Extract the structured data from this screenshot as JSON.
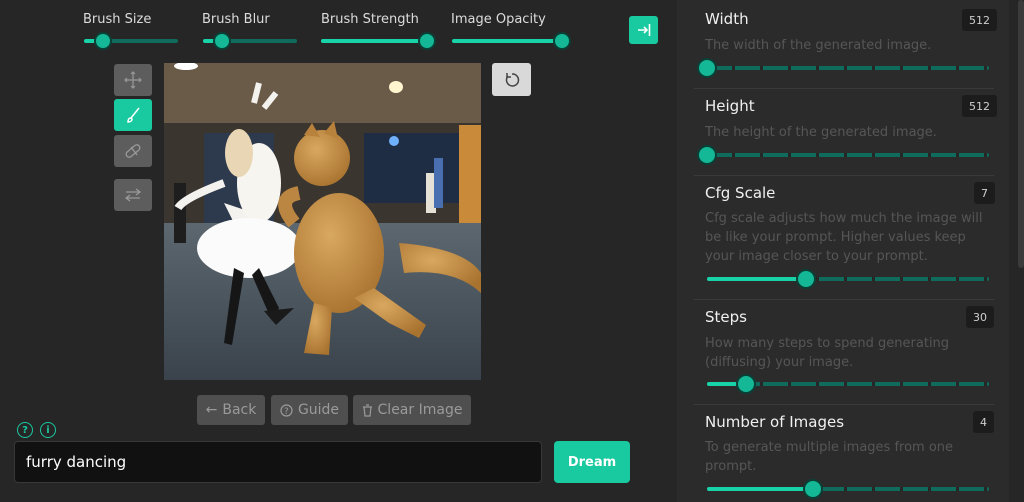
{
  "brush": {
    "size": {
      "label": "Brush Size",
      "value": 0.2
    },
    "blur": {
      "label": "Brush Blur",
      "value": 0.2
    },
    "strength": {
      "label": "Brush Strength",
      "value": 1.0
    },
    "opacity": {
      "label": "Image Opacity",
      "value": 1.0
    }
  },
  "actions": {
    "back": "Back",
    "guide": "Guide",
    "clear": "Clear Image"
  },
  "prompt": {
    "value": "furry dancing",
    "dream_label": "Dream"
  },
  "settings": {
    "width": {
      "title": "Width",
      "value": "512",
      "desc": "The width of the generated image.",
      "level": 0
    },
    "height": {
      "title": "Height",
      "value": "512",
      "desc": "The height of the generated image.",
      "level": 0
    },
    "cfg": {
      "title": "Cfg Scale",
      "value": "7",
      "desc": "Cfg scale adjusts how much the image will be like your prompt. Higher values keep your image closer to your prompt.",
      "level": 0.35
    },
    "steps": {
      "title": "Steps",
      "value": "30",
      "desc": "How many steps to spend generating (diffusing) your image.",
      "level": 0.14
    },
    "images": {
      "title": "Number of Images",
      "value": "4",
      "desc": "To generate multiple images from one prompt.",
      "level": 0.375
    }
  },
  "colors": {
    "accent": "#19c9a0",
    "track": "#0f6b5b",
    "panel": "#2b2b2b",
    "background": "#262626"
  }
}
